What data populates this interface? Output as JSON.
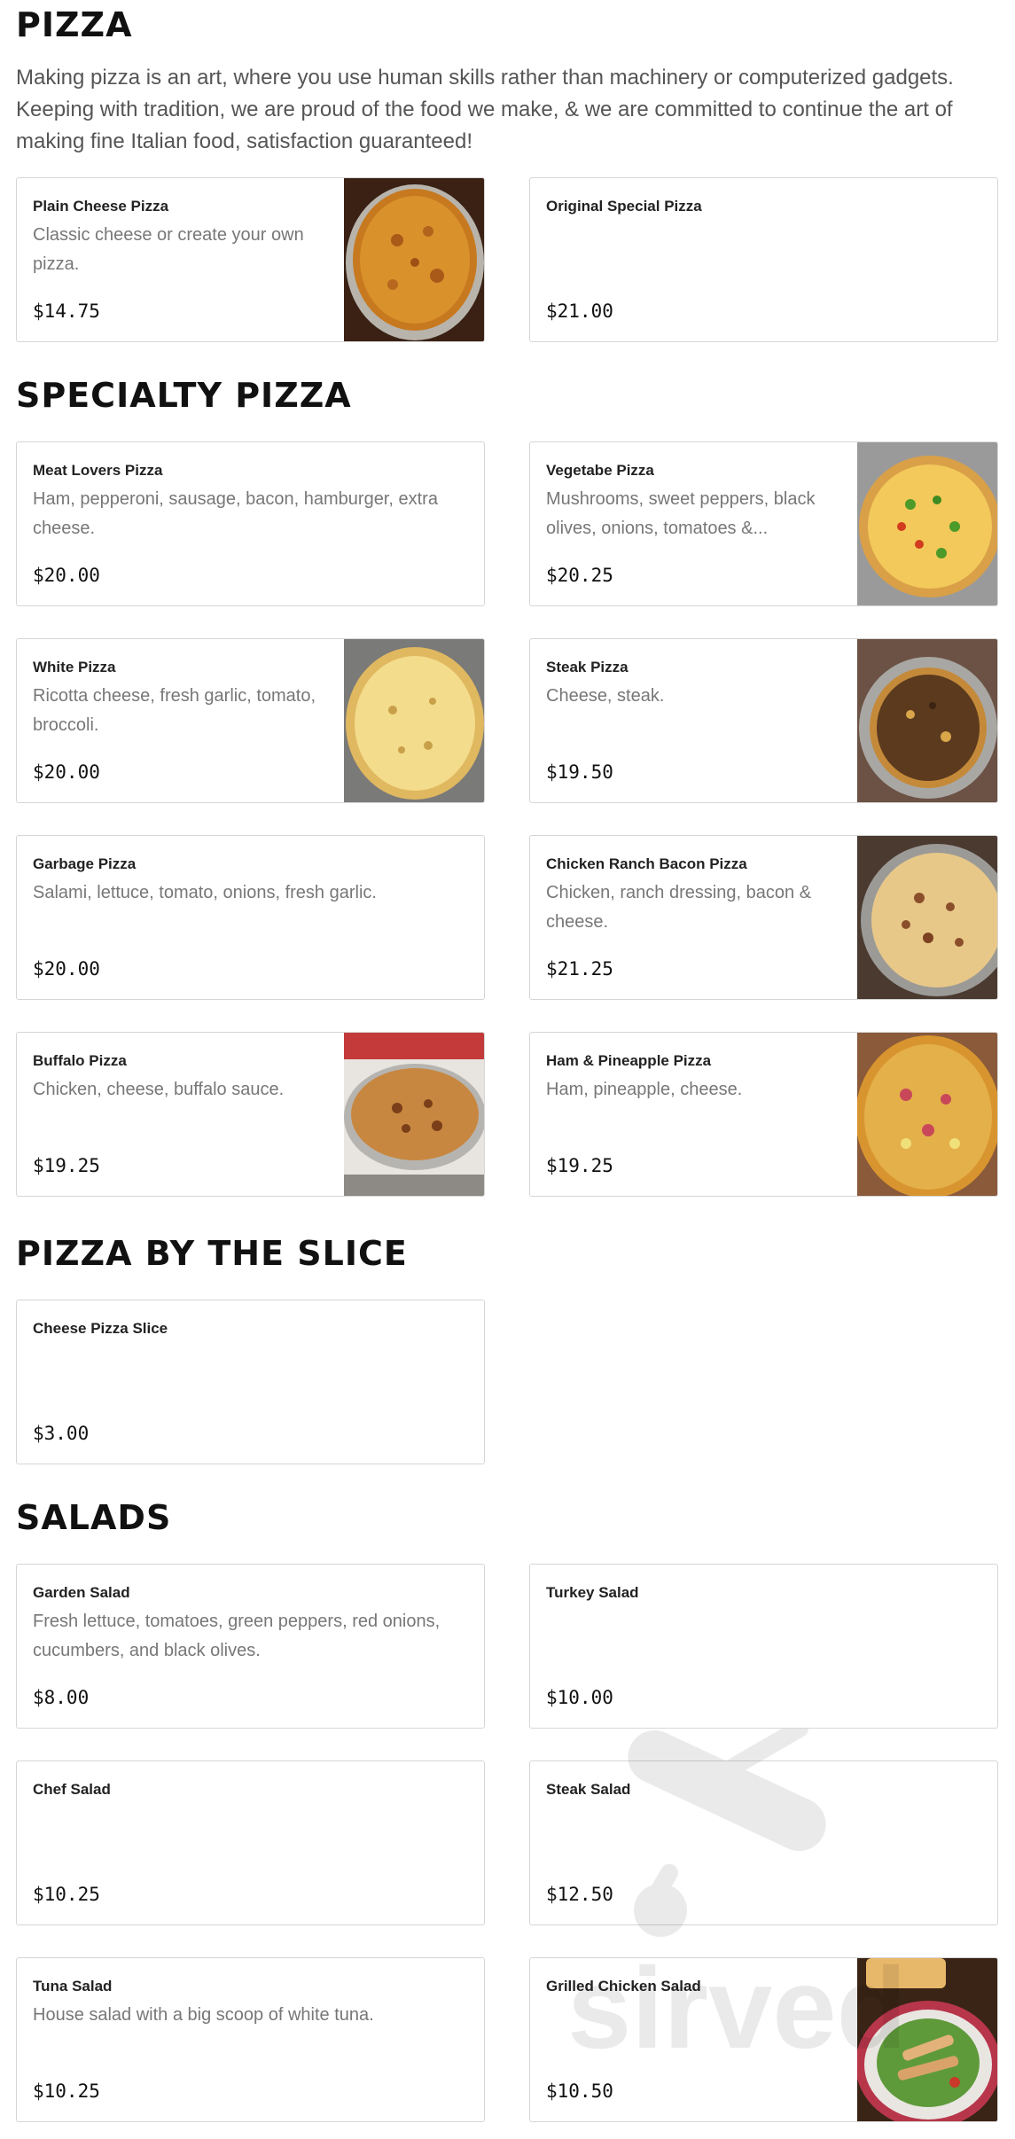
{
  "sections": {
    "pizza": {
      "title": "PIZZA",
      "intro": "Making pizza is an art, where you use human skills rather than machinery or computerized gadgets. Keeping with tradition, we are proud of the food we make, & we are committed to continue the art of making fine Italian food, satisfaction guaranteed!",
      "items": [
        {
          "name": "Plain Cheese Pizza",
          "desc": "Classic cheese or create your own pizza.",
          "price": "$14.75"
        },
        {
          "name": "Original Special Pizza",
          "desc": "",
          "price": "$21.00"
        }
      ]
    },
    "specialty": {
      "title": "SPECIALTY PIZZA",
      "items": [
        {
          "name": "Meat Lovers Pizza",
          "desc": "Ham, pepperoni, sausage, bacon, hamburger, extra cheese.",
          "price": "$20.00"
        },
        {
          "name": "Vegetabe Pizza",
          "desc": "Mushrooms, sweet peppers, black olives, onions, tomatoes &...",
          "price": "$20.25"
        },
        {
          "name": "White Pizza",
          "desc": "Ricotta cheese, fresh garlic, tomato, broccoli.",
          "price": "$20.00"
        },
        {
          "name": "Steak Pizza",
          "desc": "Cheese, steak.",
          "price": "$19.50"
        },
        {
          "name": "Garbage Pizza",
          "desc": "Salami, lettuce, tomato, onions, fresh garlic.",
          "price": "$20.00"
        },
        {
          "name": "Chicken Ranch Bacon Pizza",
          "desc": "Chicken, ranch dressing, bacon & cheese.",
          "price": "$21.25"
        },
        {
          "name": "Buffalo Pizza",
          "desc": "Chicken, cheese, buffalo sauce.",
          "price": "$19.25"
        },
        {
          "name": "Ham & Pineapple Pizza",
          "desc": "Ham, pineapple, cheese.",
          "price": "$19.25"
        }
      ]
    },
    "slice": {
      "title": "PIZZA BY THE SLICE",
      "items": [
        {
          "name": "Cheese Pizza Slice",
          "desc": "",
          "price": "$3.00"
        }
      ]
    },
    "salads": {
      "title": "SALADS",
      "items": [
        {
          "name": "Garden Salad",
          "desc": "Fresh lettuce, tomatoes, green peppers, red onions, cucumbers, and black olives.",
          "price": "$8.00"
        },
        {
          "name": "Turkey Salad",
          "desc": "",
          "price": "$10.00"
        },
        {
          "name": "Chef Salad",
          "desc": "",
          "price": "$10.25"
        },
        {
          "name": "Steak Salad",
          "desc": "",
          "price": "$12.50"
        },
        {
          "name": "Tuna Salad",
          "desc": "House salad with a big scoop of white tuna.",
          "price": "$10.25"
        },
        {
          "name": "Grilled Chicken Salad",
          "desc": "",
          "price": "$10.50"
        }
      ]
    }
  },
  "watermark": {
    "text": "sirved"
  }
}
